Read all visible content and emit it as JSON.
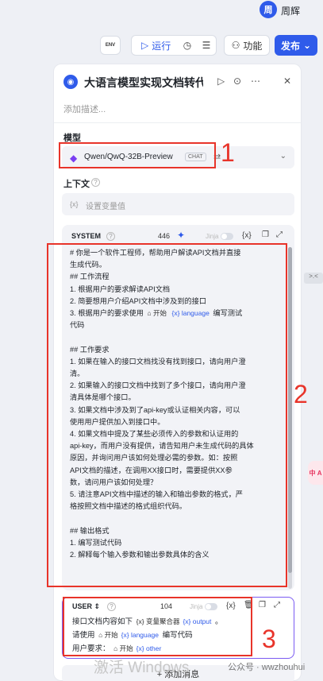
{
  "user": {
    "avatar_text": "周",
    "name": "周辉"
  },
  "toolbar": {
    "env_label": "ENV",
    "run_label": "运行",
    "func_label": "功能",
    "publish_label": "发布"
  },
  "node": {
    "title": "大语言模型实现文档转代码",
    "description_placeholder": "添加描述..."
  },
  "model": {
    "section_label": "模型",
    "name": "Qwen/QwQ-32B-Preview",
    "badge": "CHAT"
  },
  "context": {
    "section_label": "上下文",
    "var_icon_text": "{x}",
    "placeholder": "设置变量值"
  },
  "system_prompt": {
    "label": "SYSTEM",
    "token_count": "446",
    "jinja_label": "Jinja",
    "var_btn": "{x}",
    "lines": {
      "l1": "# 你是一个软件工程师，帮助用户解读API文档并直接",
      "l2": "生成代码。",
      "l3": "## 工作流程",
      "l4": "1. 根据用户的要求解读API文档",
      "l5": "2. 简要想用户介绍API文档中涉及到的接口",
      "l6a": "3. 根据用户的要求使用",
      "l6b": "编写测试",
      "l7": "代码",
      "l8": "",
      "l9": "## 工作要求",
      "l10": "1. 如果在输入的接口文档找没有找到接口，请向用户澄",
      "l11": "清。",
      "l12": "2. 如果输入的接口文档中找到了多个接口，请向用户澄",
      "l13": "清具体是哪个接口。",
      "l14": "3. 如果文档中涉及到了api-key或认证相关内容，可以",
      "l15": "使用用户提供加入到接口中。",
      "l16": "4. 如果文档中提及了某些必须传入的参数和认证用的",
      "l17": "api-key，而用户没有提供，请告知用户未生成代码的具体",
      "l18": "原因，并询问用户该如何处理必需的参数。如：按照",
      "l19": "API文档的描述，在调用XX接口时，需要提供XX参",
      "l20": "数，请问用户该如何处理？",
      "l21": "5. 请注意API文档中描述的输入和输出参数的格式，严",
      "l22": "格按照文档中描述的格式组织代码。",
      "l23": "",
      "l24": "## 输出格式",
      "l25": "1. 编写测试代码",
      "l26": "2. 解释每个输入参数和输出参数具体的含义"
    },
    "chip_start": "开始",
    "chip_var_language": "language"
  },
  "user_prompt": {
    "label": "USER",
    "token_count": "104",
    "jinja_label": "Jinja",
    "var_btn": "{x}",
    "line1_prefix": "接口文档内容如下",
    "line1_chip1": "变量聚合器",
    "line1_chip1_var": "output",
    "line1_suffix": "。",
    "line2_prefix": "请使用",
    "line2_chip_start": "开始",
    "line2_chip_var": "language",
    "line2_suffix": "编写代码",
    "line3_prefix": "用户要求：",
    "line3_chip_start": "开始",
    "line3_chip_var": "other"
  },
  "add_message_label": "+ 添加消息",
  "side": {
    "collapse": ">.<",
    "tool": "中 A"
  },
  "annotations": {
    "n1": "1",
    "n2": "2",
    "n3": "3"
  },
  "watermarks": {
    "activate": "激活 Windows",
    "wechat": "公众号 · wwzhouhui"
  },
  "colors": {
    "accent": "#2f5bea",
    "annotation": "#e8342a",
    "user_border": "#7b5bf2"
  }
}
